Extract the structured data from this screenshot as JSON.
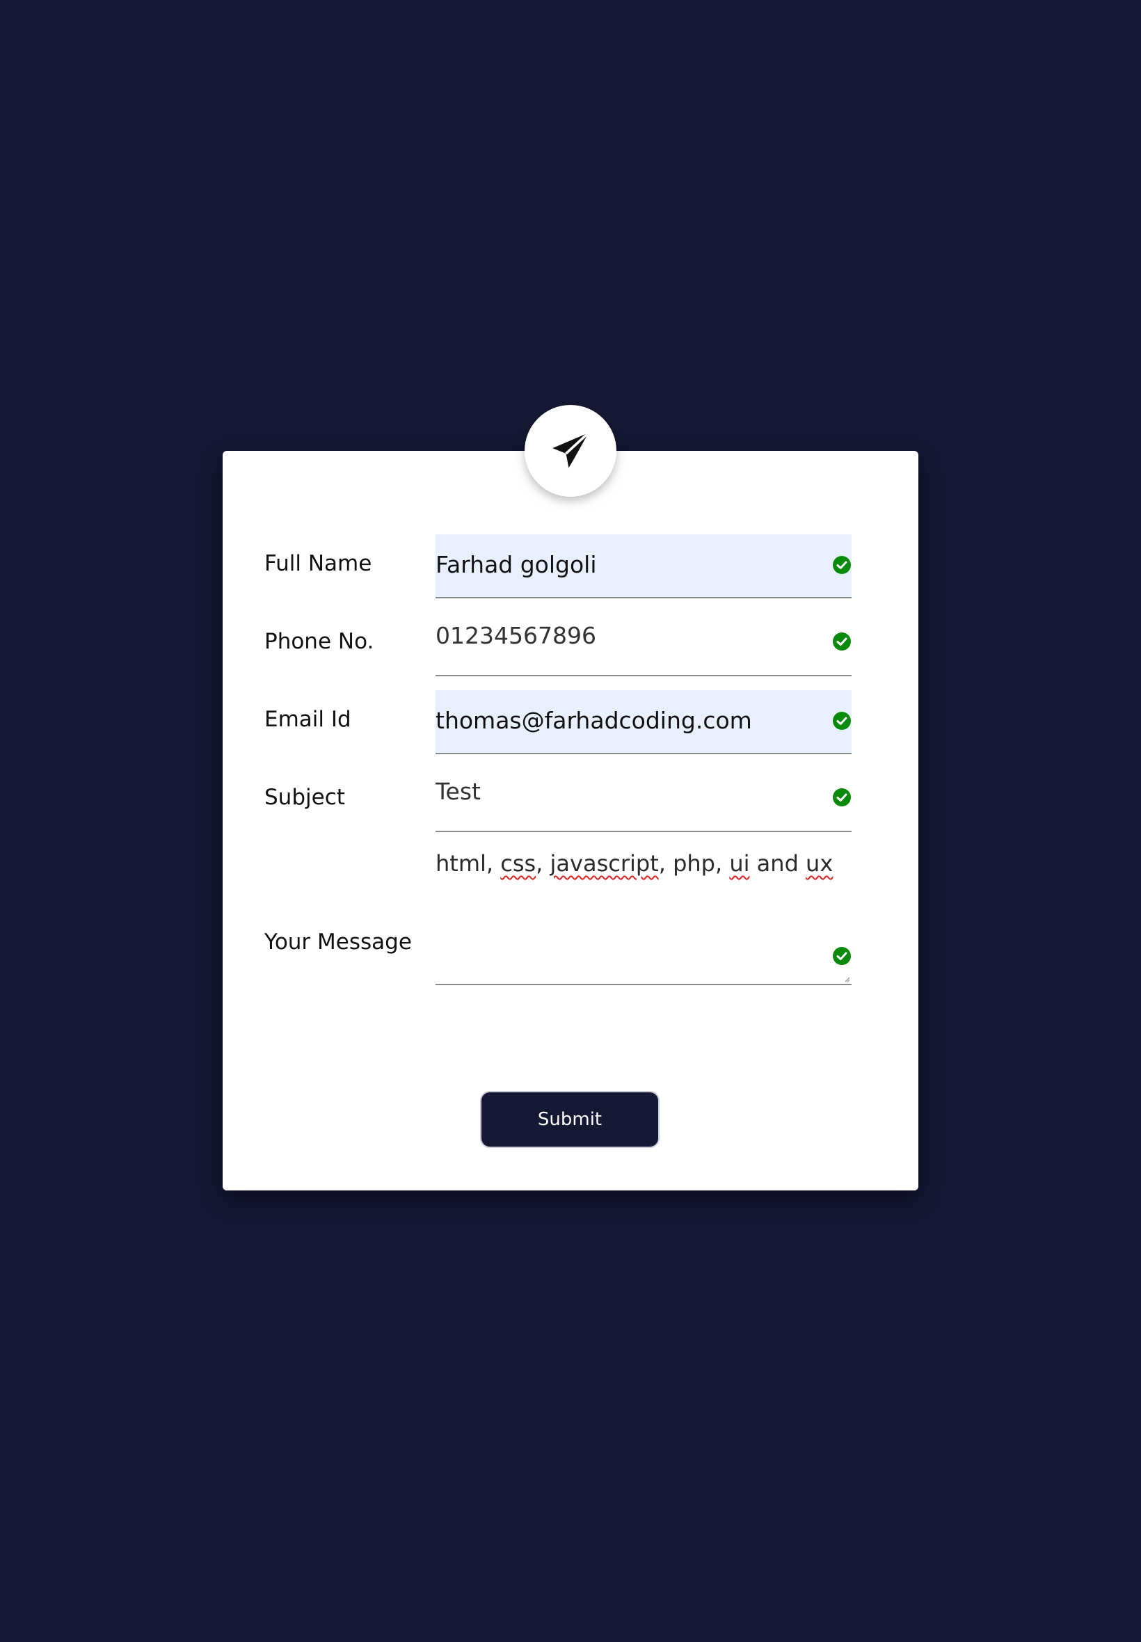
{
  "form": {
    "fields": [
      {
        "label": "Full Name",
        "value": "Farhad golgoli"
      },
      {
        "label": "Phone No.",
        "value": "01234567896"
      },
      {
        "label": "Email Id",
        "value": "thomas@farhadcoding.com"
      },
      {
        "label": "Subject",
        "value": "Test"
      }
    ],
    "message": {
      "label": "Your Message",
      "parts": [
        "html, ",
        "css",
        ", ",
        "javascript",
        ", php, ",
        "ui",
        " and ",
        "ux"
      ]
    },
    "submit_label": "Submit"
  },
  "colors": {
    "background": "#141832",
    "card": "#ffffff",
    "autofill": "#e8f0fe",
    "check": "#0a8a0a",
    "button": "#141832"
  },
  "icons": {
    "header": "paper-plane-icon",
    "valid": "check-circle-icon"
  }
}
